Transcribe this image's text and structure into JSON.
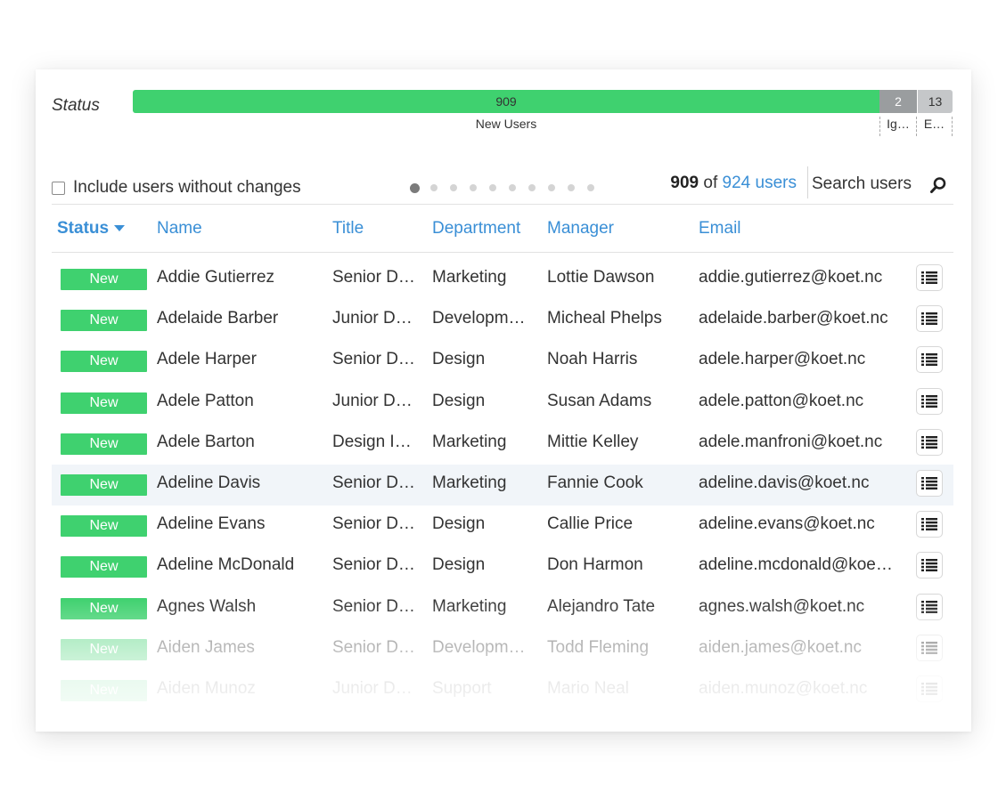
{
  "status": {
    "label": "Status",
    "segments": [
      {
        "key": "new",
        "value": "909",
        "label": "New Users"
      },
      {
        "key": "ignored",
        "value": "2",
        "label": "Ig…"
      },
      {
        "key": "errors",
        "value": "13",
        "label": "E…"
      }
    ]
  },
  "controls": {
    "include_label": "Include users without changes",
    "pagination": {
      "pages": 10,
      "current": 1
    },
    "count_shown": "909",
    "count_of": "of",
    "count_total": "924 users",
    "search_placeholder": "Search users"
  },
  "table": {
    "headers": {
      "status": "Status",
      "name": "Name",
      "title": "Title",
      "department": "Department",
      "manager": "Manager",
      "email": "Email"
    },
    "rows": [
      {
        "status": "New",
        "name": "Addie Gutierrez",
        "title": "Senior D…",
        "department": "Marketing",
        "manager": "Lottie Dawson",
        "email": "addie.gutierrez@koet.nc"
      },
      {
        "status": "New",
        "name": "Adelaide Barber",
        "title": "Junior D…",
        "department": "Developm…",
        "manager": "Micheal Phelps",
        "email": "adelaide.barber@koet.nc"
      },
      {
        "status": "New",
        "name": "Adele Harper",
        "title": "Senior D…",
        "department": "Design",
        "manager": "Noah Harris",
        "email": "adele.harper@koet.nc"
      },
      {
        "status": "New",
        "name": "Adele Patton",
        "title": "Junior D…",
        "department": "Design",
        "manager": "Susan Adams",
        "email": "adele.patton@koet.nc"
      },
      {
        "status": "New",
        "name": "Adele Barton",
        "title": "Design I…",
        "department": "Marketing",
        "manager": "Mittie Kelley",
        "email": "adele.manfroni@koet.nc"
      },
      {
        "status": "New",
        "name": "Adeline Davis",
        "title": "Senior D…",
        "department": "Marketing",
        "manager": "Fannie Cook",
        "email": "adeline.davis@koet.nc"
      },
      {
        "status": "New",
        "name": "Adeline Evans",
        "title": "Senior D…",
        "department": "Design",
        "manager": "Callie Price",
        "email": "adeline.evans@koet.nc"
      },
      {
        "status": "New",
        "name": "Adeline McDonald",
        "title": "Senior D…",
        "department": "Design",
        "manager": "Don Harmon",
        "email": "adeline.mcdonald@koe…"
      },
      {
        "status": "New",
        "name": "Agnes Walsh",
        "title": "Senior D…",
        "department": "Marketing",
        "manager": "Alejandro Tate",
        "email": "agnes.walsh@koet.nc"
      },
      {
        "status": "New",
        "name": "Aiden James",
        "title": "Senior D…",
        "department": "Developm…",
        "manager": "Todd Fleming",
        "email": "aiden.james@koet.nc"
      },
      {
        "status": "New",
        "name": "Aiden Munoz",
        "title": "Junior D…",
        "department": "Support",
        "manager": "Mario Neal",
        "email": "aiden.munoz@koet.nc"
      }
    ]
  },
  "colors": {
    "new_green": "#3fd16f",
    "ignored_gray": "#9a9d9f",
    "error_gray": "#c5c7c9",
    "link_blue": "#3a8fd6",
    "highlight_row": "#f1f5f9"
  },
  "icons": {
    "search": "search-icon",
    "details": "list-icon",
    "sort": "caret-down-icon"
  }
}
